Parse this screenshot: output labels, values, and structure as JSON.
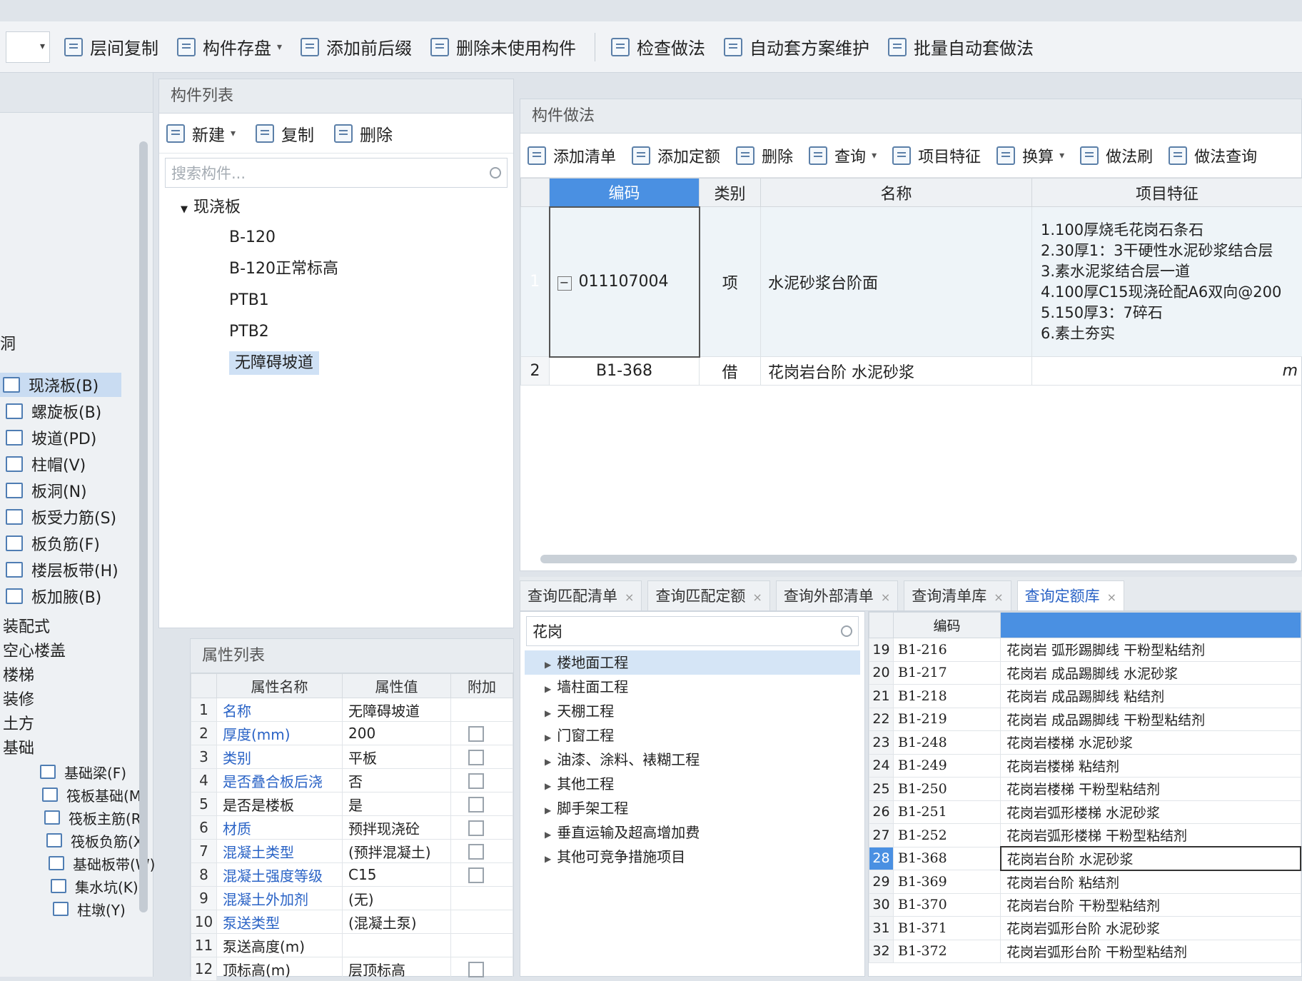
{
  "toolbar": {
    "items": [
      {
        "label": "层间复制",
        "icon": "copy-floor-icon"
      },
      {
        "label": "构件存盘",
        "icon": "save-component-icon",
        "dropdown": true
      },
      {
        "label": "添加前后缀",
        "icon": "add-affix-icon"
      },
      {
        "label": "删除未使用构件",
        "icon": "delete-unused-icon"
      },
      {
        "label": "检查做法",
        "icon": "check-method-icon"
      },
      {
        "label": "自动套方案维护",
        "icon": "auto-scheme-icon"
      },
      {
        "label": "批量自动套做法",
        "icon": "batch-auto-icon"
      }
    ]
  },
  "leftnav": {
    "side_char": "洞",
    "items": [
      {
        "label": "现浇板(B)",
        "selected": true
      },
      {
        "label": "螺旋板(B)"
      },
      {
        "label": "坡道(PD)"
      },
      {
        "label": "柱帽(V)"
      },
      {
        "label": "板洞(N)"
      },
      {
        "label": "板受力筋(S)"
      },
      {
        "label": "板负筋(F)"
      },
      {
        "label": "楼层板带(H)"
      },
      {
        "label": "板加腋(B)"
      }
    ],
    "groups": [
      {
        "label": "装配式"
      },
      {
        "label": "空心楼盖"
      },
      {
        "label": "楼梯"
      },
      {
        "label": "装修"
      },
      {
        "label": "土方"
      },
      {
        "label": "基础"
      }
    ],
    "sub_items": [
      {
        "label": "基础梁(F)"
      },
      {
        "label": "筏板基础(M)"
      },
      {
        "label": "筏板主筋(R)"
      },
      {
        "label": "筏板负筋(X)"
      },
      {
        "label": "基础板带(W)"
      },
      {
        "label": "集水坑(K)"
      },
      {
        "label": "柱墩(Y)"
      }
    ]
  },
  "complist": {
    "title": "构件列表",
    "new_label": "新建",
    "copy_label": "复制",
    "delete_label": "删除",
    "search_placeholder": "搜索构件...",
    "tree_root": "现浇板",
    "items": [
      "B-120",
      "B-120正常标高",
      "PTB1",
      "PTB2",
      "无障碍坡道"
    ],
    "selected_index": 4
  },
  "props": {
    "title": "属性列表",
    "headers": [
      "属性名称",
      "属性值",
      "附加"
    ],
    "rows": [
      {
        "n": "1",
        "name": "名称",
        "value": "无障碍坡道",
        "link": true,
        "cb": false
      },
      {
        "n": "2",
        "name": "厚度(mm)",
        "value": "200",
        "link": true,
        "cb": true
      },
      {
        "n": "3",
        "name": "类别",
        "value": "平板",
        "link": true,
        "cb": true
      },
      {
        "n": "4",
        "name": "是否叠合板后浇",
        "value": "否",
        "link": true,
        "cb": true
      },
      {
        "n": "5",
        "name": "是否是楼板",
        "value": "是",
        "link": false,
        "cb": true
      },
      {
        "n": "6",
        "name": "材质",
        "value": "预拌现浇砼",
        "link": true,
        "cb": true
      },
      {
        "n": "7",
        "name": "混凝土类型",
        "value": "(预拌混凝土)",
        "link": true,
        "cb": true
      },
      {
        "n": "8",
        "name": "混凝土强度等级",
        "value": "C15",
        "link": true,
        "cb": true
      },
      {
        "n": "9",
        "name": "混凝土外加剂",
        "value": "(无)",
        "link": true,
        "cb": false
      },
      {
        "n": "10",
        "name": "泵送类型",
        "value": "(混凝土泵)",
        "link": true,
        "cb": false
      },
      {
        "n": "11",
        "name": "泵送高度(m)",
        "value": "",
        "link": false,
        "cb": false
      },
      {
        "n": "12",
        "name": "顶标高(m)",
        "value": "层顶标高",
        "link": false,
        "cb": true
      }
    ]
  },
  "method": {
    "title": "构件做法",
    "tools": [
      {
        "label": "添加清单",
        "icon": "add-list-icon"
      },
      {
        "label": "添加定额",
        "icon": "add-quota-icon"
      },
      {
        "label": "删除",
        "icon": "trash-icon"
      },
      {
        "label": "查询",
        "icon": "query-icon",
        "dropdown": true
      },
      {
        "label": "项目特征",
        "icon": "feature-icon"
      },
      {
        "label": "换算",
        "icon": "fx-icon",
        "dropdown": true
      },
      {
        "label": "做法刷",
        "icon": "brush-icon"
      },
      {
        "label": "做法查询",
        "icon": "method-query-icon"
      }
    ],
    "headers": [
      "编码",
      "类别",
      "名称",
      "项目特征"
    ],
    "rows": [
      {
        "n": "1",
        "code": "011107004",
        "type": "项",
        "name": "水泥砂浆台阶面",
        "features": [
          "1.100厚烧毛花岗石条石",
          "2.30厚1：3干硬性水泥砂浆结合层",
          "3.素水泥浆结合层一道",
          "4.100厚C15现浇砼配A6双向@200",
          "5.150厚3：7碎石",
          "6.素土夯实"
        ]
      },
      {
        "n": "2",
        "code": "B1-368",
        "type": "借",
        "name": "花岗岩台阶 水泥砂浆",
        "features": [],
        "extra": "m"
      }
    ]
  },
  "tabs": [
    {
      "label": "查询匹配清单",
      "active": false
    },
    {
      "label": "查询匹配定额",
      "active": false
    },
    {
      "label": "查询外部清单",
      "active": false
    },
    {
      "label": "查询清单库",
      "active": false
    },
    {
      "label": "查询定额库",
      "active": true
    }
  ],
  "chapters": {
    "search_value": "花岗",
    "items": [
      "楼地面工程",
      "墙柱面工程",
      "天棚工程",
      "门窗工程",
      "油漆、涂料、裱糊工程",
      "其他工程",
      "脚手架工程",
      "垂直运输及超高增加费",
      "其他可竞争措施项目"
    ],
    "selected_index": 0
  },
  "quota": {
    "header_code": "编码",
    "rows": [
      {
        "n": "19",
        "code": "B1-216",
        "name": "花岗岩 弧形踢脚线 干粉型粘结剂"
      },
      {
        "n": "20",
        "code": "B1-217",
        "name": "花岗岩 成品踢脚线 水泥砂浆"
      },
      {
        "n": "21",
        "code": "B1-218",
        "name": "花岗岩 成品踢脚线 粘结剂"
      },
      {
        "n": "22",
        "code": "B1-219",
        "name": "花岗岩 成品踢脚线 干粉型粘结剂"
      },
      {
        "n": "23",
        "code": "B1-248",
        "name": "花岗岩楼梯 水泥砂浆"
      },
      {
        "n": "24",
        "code": "B1-249",
        "name": "花岗岩楼梯 粘结剂"
      },
      {
        "n": "25",
        "code": "B1-250",
        "name": "花岗岩楼梯 干粉型粘结剂"
      },
      {
        "n": "26",
        "code": "B1-251",
        "name": "花岗岩弧形楼梯 水泥砂浆"
      },
      {
        "n": "27",
        "code": "B1-252",
        "name": "花岗岩弧形楼梯 干粉型粘结剂"
      },
      {
        "n": "28",
        "code": "B1-368",
        "name": "花岗岩台阶 水泥砂浆",
        "selected": true
      },
      {
        "n": "29",
        "code": "B1-369",
        "name": "花岗岩台阶 粘结剂"
      },
      {
        "n": "30",
        "code": "B1-370",
        "name": "花岗岩台阶 干粉型粘结剂"
      },
      {
        "n": "31",
        "code": "B1-371",
        "name": "花岗岩弧形台阶 水泥砂浆"
      },
      {
        "n": "32",
        "code": "B1-372",
        "name": "花岗岩弧形台阶 干粉型粘结剂"
      }
    ]
  }
}
